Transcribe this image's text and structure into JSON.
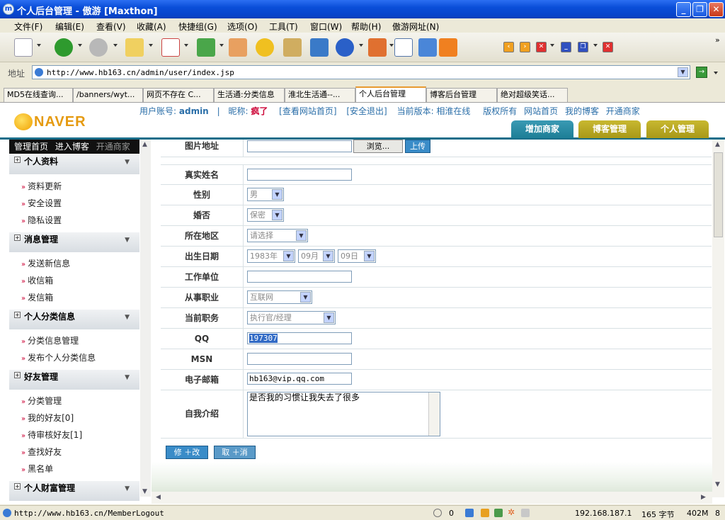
{
  "window": {
    "title": "个人后台管理 - 傲游 [Maxthon]"
  },
  "menu": [
    "文件(F)",
    "编辑(E)",
    "查看(V)",
    "收藏(A)",
    "快捷组(G)",
    "选项(O)",
    "工具(T)",
    "窗口(W)",
    "帮助(H)",
    "傲游网址(N)"
  ],
  "address": {
    "label": "地址",
    "url": "http://www.hb163.cn/admin/user/index.jsp"
  },
  "tabs": [
    "MD5在线查询...",
    "/banners/wyt...",
    "网页不存在 C...",
    "生活通:分类信息",
    "淮北生活通--...",
    "个人后台管理",
    "博客后台管理",
    "绝对超级笑话..."
  ],
  "active_tab": 5,
  "header": {
    "logo": "NAVER",
    "account_label": "用户账号:",
    "account": "admin",
    "separator": "|",
    "nickname_label": "昵称:",
    "nickname": "疯了",
    "link_view_site": "[查看网站首页]",
    "link_logout": "[安全退出]",
    "version": "当前版本: 相淮在线",
    "copyright": "版权所有",
    "site_home": "网站首页",
    "my_blog": "我的博客",
    "open_merchant": "开通商家",
    "tabs": [
      "增加商家",
      "博客管理",
      "个人管理"
    ]
  },
  "sidebar": {
    "top": [
      "管理首页",
      "进入博客",
      "开通商家"
    ],
    "groups": [
      {
        "title": "个人资料",
        "items": [
          "资料更新",
          "安全设置",
          "隐私设置"
        ]
      },
      {
        "title": "消息管理",
        "items": [
          "发送新信息",
          "收信箱",
          "发信箱"
        ]
      },
      {
        "title": "个人分类信息",
        "items": [
          "分类信息管理",
          "发布个人分类信息"
        ]
      },
      {
        "title": "好友管理",
        "items": [
          "分类管理",
          "我的好友[0]",
          "待审核好友[1]",
          "查找好友",
          "黑名单"
        ]
      },
      {
        "title": "个人财富管理",
        "items": []
      }
    ]
  },
  "form": {
    "photo_label": "图片地址",
    "browse_btn": "浏览...",
    "upload_btn": "上传",
    "realname_label": "真实姓名",
    "gender_label": "性别",
    "gender_value": "男",
    "marital_label": "婚否",
    "marital_value": "保密",
    "region_label": "所在地区",
    "region_value": "请选择",
    "birth_label": "出生日期",
    "birth_year": "1983年",
    "birth_month": "09月",
    "birth_day": "09日",
    "employer_label": "工作单位",
    "occupation_label": "从事职业",
    "occupation_value": "互联网",
    "position_label": "当前职务",
    "position_value": "执行官/经理",
    "qq_label": "QQ",
    "qq_value": "197307",
    "msn_label": "MSN",
    "email_label": "电子邮箱",
    "email_value": "hb163@vip.qq.com",
    "intro_label": "自我介绍",
    "intro_value": "是否我的习惯让我失去了很多",
    "submit_btn": "修 ＋改",
    "cancel_btn": "取 ＋消"
  },
  "status": {
    "url": "http://www.hb163.cn/MemberLogout",
    "count": "0",
    "ip": "192.168.187.1",
    "bytes": "165 字节",
    "memory": "402M",
    "num": "8"
  },
  "colors": {
    "titlebar": "#0a4ed8",
    "header_rule": "#1a6e8a",
    "tab_teal": "#1d7e96",
    "tab_olive": "#b0a020",
    "link": "#2a6ea8",
    "button": "#3a8cc8"
  }
}
